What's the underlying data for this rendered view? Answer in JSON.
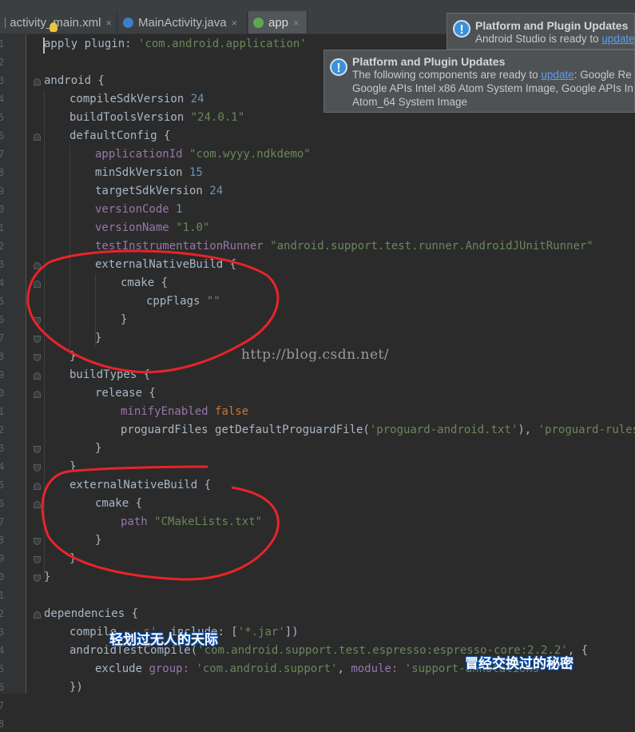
{
  "tabs": [
    {
      "label": "activity_main.xml",
      "close": "×",
      "icon": "xml-file-icon",
      "active": false
    },
    {
      "label": "MainActivity.java",
      "close": "×",
      "icon": "class-file-icon",
      "active": false
    },
    {
      "label": "app",
      "close": "×",
      "icon": "gradle-file-icon",
      "active": true
    }
  ],
  "notifications": [
    {
      "title": "Platform and Plugin Updates",
      "text_before": "Android Studio is ready to ",
      "link": "update"
    },
    {
      "title": "Platform and Plugin Updates",
      "line1_before": "The following components are ready to ",
      "link": "update",
      "line1_after": ": Google Re",
      "line2": "Google APIs Intel x86 Atom System Image, Google APIs In",
      "line3": "Atom_64 System Image"
    }
  ],
  "line_numbers": [
    "1",
    "2",
    "3",
    "4",
    "5",
    "6",
    "7",
    "8",
    "9",
    "0",
    "1",
    "2",
    "3",
    "4",
    "5",
    "6",
    "7",
    "8",
    "9",
    "0",
    "1",
    "2",
    "3",
    "4",
    "5",
    "6",
    "7",
    "8",
    "9",
    "0",
    "1",
    "2",
    "3",
    "4",
    "5",
    "6",
    "7",
    "8"
  ],
  "code": {
    "l1": [
      "apply plugin: ",
      "'com.android.application'"
    ],
    "l3": "android {",
    "l4": [
      "compileSdkVersion ",
      "24"
    ],
    "l5": [
      "buildToolsVersion ",
      "\"24.0.1\""
    ],
    "l6": "defaultConfig {",
    "l7": [
      "applicationId ",
      "\"com.wyyy.ndkdemo\""
    ],
    "l8": [
      "minSdkVersion ",
      "15"
    ],
    "l9": [
      "targetSdkVersion ",
      "24"
    ],
    "l10": [
      "versionCode ",
      "1"
    ],
    "l11": [
      "versionName ",
      "\"1.0\""
    ],
    "l12": [
      "testInstrumentationRunner ",
      "\"android.support.test.runner.AndroidJUnitRunner\""
    ],
    "l13": "externalNativeBuild {",
    "l14": "cmake {",
    "l15": [
      "cppFlags ",
      "\"\""
    ],
    "l16": "}",
    "l17": "}",
    "l18": "}",
    "l19": "buildTypes {",
    "l20": "release {",
    "l21": [
      "minifyEnabled ",
      "false"
    ],
    "l22": [
      "proguardFiles getDefaultProguardFile(",
      "'proguard-android.txt'",
      "), ",
      "'proguard-rules.pro"
    ],
    "l23": "}",
    "l24": "}",
    "l25": "externalNativeBuild {",
    "l26": "cmake {",
    "l27": [
      "path ",
      "\"CMakeLists.txt\""
    ],
    "l28": "}",
    "l29": "}",
    "l30": "}",
    "l32": "dependencies {",
    "l33": [
      "compile",
      "    ",
      "s'",
      ", include: [",
      "'*.jar'",
      "])"
    ],
    "l34": [
      "androidTestCompile(",
      "'com.android.support.test.espresso:espresso-core:2.2.2'",
      ", {"
    ],
    "l35": [
      "exclude ",
      "group: ",
      "'com.android.support'",
      ", ",
      "module: ",
      "'support-annotations'"
    ],
    "l36": "})"
  },
  "watermark": "http://blog.csdn.net/",
  "subtitles": [
    "轻划过无人的天际",
    "冒经交换过的秘密"
  ],
  "colors": {
    "background": "#2b2b2b",
    "string": "#6a8759",
    "number": "#6897bb",
    "keyword": "#cc7832",
    "property": "#9876aa",
    "annotation": "#e8242a"
  }
}
